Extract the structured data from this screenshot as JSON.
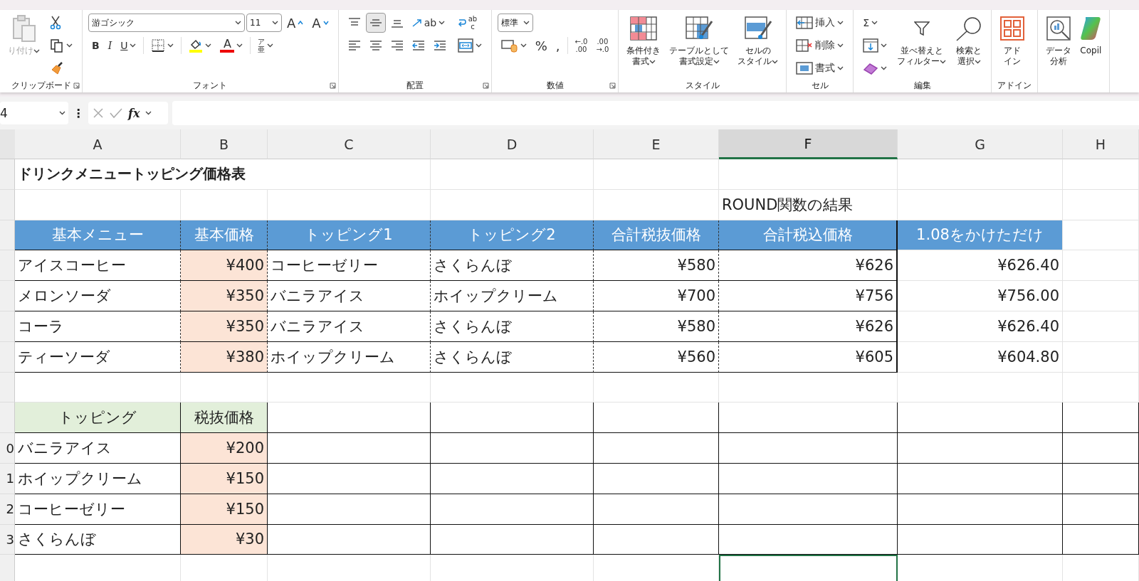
{
  "ribbon": {
    "groups": [
      {
        "label": "クリップボード",
        "launcher": true,
        "blocks": [
          {
            "kind": "large",
            "lines": [
              "り付け"
            ],
            "menu": true,
            "disabled": true
          },
          {
            "kind": "stack",
            "rows": [
              {
                "items": [
                  {
                    "kind": "cut"
                  }
                ]
              },
              {
                "items": [
                  {
                    "kind": "copy",
                    "menu": true
                  }
                ]
              },
              {
                "items": [
                  {
                    "kind": "painter"
                  }
                ]
              }
            ]
          }
        ]
      },
      {
        "label": "フォント",
        "launcher": true,
        "blocks": [
          {
            "kind": "stack",
            "rows": [
              {
                "items": [
                  {
                    "kind": "field",
                    "value": "游ゴシック"
                  },
                  {
                    "kind": "field",
                    "value": "11"
                  },
                  {
                    "kind": "grow",
                    "label": "A"
                  },
                  {
                    "kind": "shrink",
                    "label": "A"
                  }
                ]
              },
              {
                "items": [
                  {
                    "kind": "bold",
                    "label": "B"
                  },
                  {
                    "kind": "italic",
                    "label": "I"
                  },
                  {
                    "kind": "underline",
                    "label": "U",
                    "menu": true
                  },
                  {
                    "kind": "sep"
                  },
                  {
                    "kind": "borders",
                    "menu": true
                  },
                  {
                    "kind": "sep"
                  },
                  {
                    "kind": "fill",
                    "menu": true
                  },
                  {
                    "kind": "fontcolor",
                    "label": "A",
                    "menu": true
                  },
                  {
                    "kind": "sep"
                  },
                  {
                    "kind": "phonetic",
                    "lines": [
                      "ア",
                      "亜"
                    ],
                    "menu": true
                  }
                ]
              }
            ]
          }
        ]
      },
      {
        "label": "配置",
        "launcher": true,
        "blocks": [
          {
            "kind": "stack",
            "rows": [
              {
                "items": [
                  {
                    "kind": "top",
                    "selected": false
                  },
                  {
                    "kind": "middle",
                    "selected": true
                  },
                  {
                    "kind": "bottom",
                    "selected": false
                  },
                  {
                    "kind": "orient",
                    "label": "ab",
                    "menu": true
                  }
                ]
              },
              {
                "items": [
                  {
                    "kind": "left"
                  },
                  {
                    "kind": "center"
                  },
                  {
                    "kind": "right"
                  },
                  {
                    "kind": "outdent"
                  },
                  {
                    "kind": "indent"
                  }
                ]
              }
            ]
          },
          {
            "kind": "stack",
            "rows": [
              {
                "items": [
                  {
                    "kind": "wrap",
                    "lines": [
                      "ab",
                      "c"
                    ]
                  }
                ]
              },
              {
                "items": [
                  {
                    "kind": "merge",
                    "menu": true
                  }
                ]
              }
            ]
          }
        ]
      },
      {
        "label": "数値",
        "launcher": true,
        "blocks": [
          {
            "kind": "stack",
            "rows": [
              {
                "items": [
                  {
                    "kind": "field",
                    "value": "標準"
                  }
                ]
              },
              {
                "items": [
                  {
                    "kind": "currency",
                    "menu": true
                  },
                  {
                    "kind": "percent",
                    "label": "%"
                  },
                  {
                    "kind": "comma",
                    "label": ","
                  },
                  {
                    "kind": "sep"
                  },
                  {
                    "kind": "incdec",
                    "lines": [
                      "←.0",
                      ".00"
                    ]
                  },
                  {
                    "kind": "decdec",
                    "lines": [
                      ".00",
                      "→.0"
                    ]
                  }
                ]
              }
            ]
          }
        ]
      },
      {
        "label": "スタイル",
        "blocks": [
          {
            "kind": "large",
            "lines": [
              "条件付き",
              "書式"
            ],
            "menu": true
          },
          {
            "kind": "large",
            "lines": [
              "テーブルとして",
              "書式設定"
            ],
            "menu": true
          },
          {
            "kind": "large",
            "lines": [
              "セルの",
              "スタイル"
            ],
            "menu": true
          }
        ]
      },
      {
        "label": "セル",
        "blocks": [
          {
            "kind": "stack",
            "rows": [
              {
                "items": [
                  {
                    "kind": "insert",
                    "label": "挿入",
                    "menu": true
                  }
                ]
              },
              {
                "items": [
                  {
                    "kind": "delete",
                    "label": "削除",
                    "menu": true
                  }
                ]
              },
              {
                "items": [
                  {
                    "kind": "format",
                    "label": "書式",
                    "menu": true
                  }
                ]
              }
            ]
          }
        ]
      },
      {
        "label": "編集",
        "blocks": [
          {
            "kind": "stack",
            "rows": [
              {
                "items": [
                  {
                    "kind": "sum",
                    "label": "Σ",
                    "menu": true
                  }
                ]
              },
              {
                "items": [
                  {
                    "kind": "filldown",
                    "menu": true
                  }
                ]
              },
              {
                "items": [
                  {
                    "kind": "clear",
                    "menu": true
                  }
                ]
              }
            ]
          },
          {
            "kind": "large",
            "lines": [
              "並べ替えと",
              "フィルター"
            ],
            "menu": true
          },
          {
            "kind": "large",
            "lines": [
              "検索と",
              "選択"
            ],
            "menu": true
          }
        ]
      },
      {
        "label": "アドイン",
        "blocks": [
          {
            "kind": "large",
            "lines": [
              "アド",
              "イン"
            ]
          }
        ]
      },
      {
        "blocks": [
          {
            "kind": "large",
            "lines": [
              "データ",
              "分析"
            ]
          },
          {
            "kind": "large",
            "lines": [
              "Copil"
            ]
          }
        ]
      }
    ]
  },
  "formula_bar": {
    "name_box": "4",
    "more": "⋮",
    "function_label": "fx"
  },
  "sheet": {
    "columns": [
      {
        "label": "A",
        "selected": false
      },
      {
        "label": "B",
        "selected": false
      },
      {
        "label": "C",
        "selected": false
      },
      {
        "label": "D",
        "selected": false
      },
      {
        "label": "E",
        "selected": false
      },
      {
        "label": "F",
        "selected": true
      },
      {
        "label": "G",
        "selected": false
      },
      {
        "label": "H",
        "selected": false
      }
    ],
    "rows": [
      {
        "kind": "plain",
        "cells": [
          {
            "text": "ドリンクメニュートッピング価格表",
            "kind": "title",
            "selected": false
          }
        ]
      },
      {
        "kind": "plain",
        "cells": [
          {
            "selected": false
          },
          {
            "selected": false
          },
          {
            "selected": false
          },
          {
            "selected": false
          },
          {
            "selected": false
          },
          {
            "text": "ROUND関数の結果",
            "kind": "note",
            "selected": false
          }
        ]
      },
      {
        "kind": "main",
        "cells": [
          {
            "text": "基本メニュー",
            "kind": "heading",
            "selected": false
          },
          {
            "text": "基本価格",
            "kind": "heading",
            "selected": false
          },
          {
            "text": "トッピング1",
            "kind": "heading",
            "selected": false
          },
          {
            "text": "トッピング2",
            "kind": "heading",
            "selected": false
          },
          {
            "text": "合計税抜価格",
            "kind": "heading",
            "selected": false
          },
          {
            "text": "合計税込価格",
            "kind": "heading",
            "selected": false
          },
          {
            "text": "1.08をかけただけ",
            "kind": "heading",
            "selected": false
          }
        ]
      },
      {
        "kind": "main",
        "cells": [
          {
            "text": "アイスコーヒー",
            "kind": "item",
            "selected": false
          },
          {
            "text": "¥400",
            "kind": "price",
            "selected": false
          },
          {
            "text": "コーヒーゼリー",
            "kind": "item",
            "selected": false
          },
          {
            "text": "さくらんぼ",
            "kind": "item",
            "selected": false
          },
          {
            "text": "¥580",
            "kind": "amount",
            "selected": false
          },
          {
            "text": "¥626",
            "kind": "amount",
            "selected": false
          },
          {
            "text": "¥626.40",
            "kind": "amount",
            "selected": false
          }
        ]
      },
      {
        "kind": "main",
        "cells": [
          {
            "text": "メロンソーダ",
            "kind": "item",
            "selected": false
          },
          {
            "text": "¥350",
            "kind": "price",
            "selected": false
          },
          {
            "text": "バニラアイス",
            "kind": "item",
            "selected": false
          },
          {
            "text": "ホイップクリーム",
            "kind": "item",
            "selected": false
          },
          {
            "text": "¥700",
            "kind": "amount",
            "selected": false
          },
          {
            "text": "¥756",
            "kind": "amount",
            "selected": false
          },
          {
            "text": "¥756.00",
            "kind": "amount",
            "selected": false
          }
        ]
      },
      {
        "kind": "main",
        "cells": [
          {
            "text": "コーラ",
            "kind": "item",
            "selected": false
          },
          {
            "text": "¥350",
            "kind": "price",
            "selected": false
          },
          {
            "text": "バニラアイス",
            "kind": "item",
            "selected": false
          },
          {
            "text": "さくらんぼ",
            "kind": "item",
            "selected": false
          },
          {
            "text": "¥580",
            "kind": "amount",
            "selected": false
          },
          {
            "text": "¥626",
            "kind": "amount",
            "selected": false
          },
          {
            "text": "¥626.40",
            "kind": "amount",
            "selected": false
          }
        ]
      },
      {
        "kind": "main",
        "cells": [
          {
            "text": "ティーソーダ",
            "kind": "item",
            "selected": false
          },
          {
            "text": "¥380",
            "kind": "price",
            "selected": false
          },
          {
            "text": "ホイップクリーム",
            "kind": "item",
            "selected": false
          },
          {
            "text": "さくらんぼ",
            "kind": "item",
            "selected": false
          },
          {
            "text": "¥560",
            "kind": "amount",
            "selected": false
          },
          {
            "text": "¥605",
            "kind": "amount",
            "selected": false
          },
          {
            "text": "¥604.80",
            "kind": "amount",
            "selected": false
          }
        ]
      },
      {
        "kind": "plain",
        "cells": []
      },
      {
        "kind": "topping",
        "cells": [
          {
            "text": "トッピング",
            "kind": "subheading",
            "selected": false
          },
          {
            "text": "税抜価格",
            "kind": "subheading",
            "selected": false
          }
        ]
      },
      {
        "kind": "topping",
        "number": "0",
        "cells": [
          {
            "text": "バニラアイス",
            "kind": "item",
            "selected": false
          },
          {
            "text": "¥200",
            "kind": "price",
            "selected": false
          }
        ]
      },
      {
        "kind": "topping",
        "number": "1",
        "cells": [
          {
            "text": "ホイップクリーム",
            "kind": "item",
            "selected": false
          },
          {
            "text": "¥150",
            "kind": "price",
            "selected": false
          }
        ]
      },
      {
        "kind": "topping",
        "number": "2",
        "cells": [
          {
            "text": "コーヒーゼリー",
            "kind": "item",
            "selected": false
          },
          {
            "text": "¥150",
            "kind": "price",
            "selected": false
          }
        ]
      },
      {
        "kind": "topping",
        "number": "3",
        "cells": [
          {
            "text": "さくらんぼ",
            "kind": "item",
            "selected": false
          },
          {
            "text": "¥30",
            "kind": "price",
            "selected": false
          }
        ]
      },
      {
        "kind": "plain",
        "cells": [
          {
            "selected": false
          },
          {
            "selected": false
          },
          {
            "selected": false
          },
          {
            "selected": false
          },
          {
            "selected": false
          },
          {
            "selected": true
          }
        ]
      }
    ]
  }
}
